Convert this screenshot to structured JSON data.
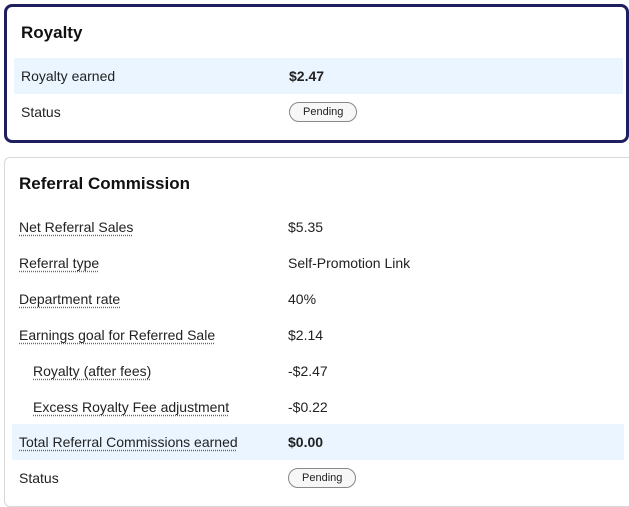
{
  "royalty": {
    "title": "Royalty",
    "earned_label": "Royalty earned",
    "earned_value": "$2.47",
    "status_label": "Status",
    "status_value": "Pending"
  },
  "referral": {
    "title": "Referral Commission",
    "rows": [
      {
        "label": "Net Referral Sales",
        "value": "$5.35"
      },
      {
        "label": "Referral type",
        "value": "Self-Promotion Link"
      },
      {
        "label": "Department rate",
        "value": "40%"
      },
      {
        "label": "Earnings goal for Referred Sale",
        "value": "$2.14"
      },
      {
        "label": "Royalty (after fees)",
        "value": "-$2.47"
      },
      {
        "label": "Excess Royalty Fee adjustment",
        "value": "-$0.22"
      },
      {
        "label": "Total Referral Commissions earned",
        "value": "$0.00"
      }
    ],
    "status_label": "Status",
    "status_value": "Pending"
  },
  "colors": {
    "royalty_border": "#1f1f5f",
    "highlight_row": "#eaf5ff"
  }
}
